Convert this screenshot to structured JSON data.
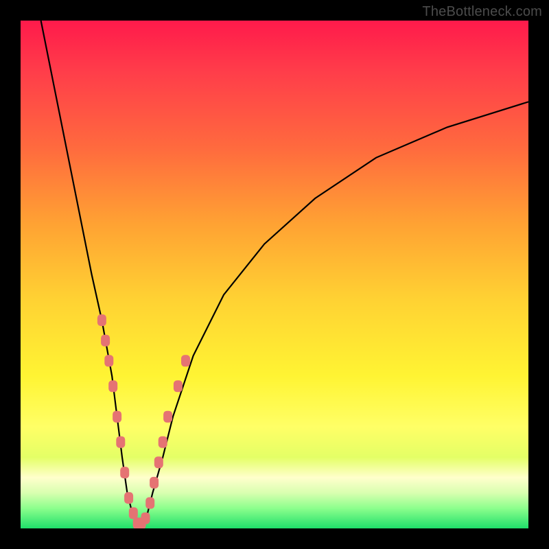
{
  "watermark": "TheBottleneck.com",
  "chart_data": {
    "type": "line",
    "title": "",
    "xlabel": "",
    "ylabel": "",
    "xlim": [
      0,
      100
    ],
    "ylim": [
      0,
      100
    ],
    "background_gradient": {
      "direction": "vertical",
      "stops": [
        {
          "pos": 0,
          "color": "#ff1a4b"
        },
        {
          "pos": 25,
          "color": "#ff6a3e"
        },
        {
          "pos": 55,
          "color": "#ffd233"
        },
        {
          "pos": 80,
          "color": "#ffff66"
        },
        {
          "pos": 100,
          "color": "#1fdf6a"
        }
      ]
    },
    "series": [
      {
        "name": "bottleneck-curve",
        "color": "#000000",
        "x": [
          4,
          6,
          8,
          10,
          12,
          14,
          16,
          18,
          19,
          20,
          21,
          22,
          23,
          24,
          25,
          26,
          28,
          30,
          34,
          40,
          48,
          58,
          70,
          84,
          100
        ],
        "y": [
          100,
          90,
          80,
          70,
          60,
          50,
          41,
          30,
          22,
          14,
          7,
          3,
          1,
          1,
          3,
          7,
          14,
          22,
          34,
          46,
          56,
          65,
          73,
          79,
          84
        ]
      }
    ],
    "markers": {
      "name": "highlight-points",
      "color": "#e57373",
      "shape": "rounded-rect",
      "points_xy": [
        [
          16,
          41
        ],
        [
          16.7,
          37
        ],
        [
          17.4,
          33
        ],
        [
          18.2,
          28
        ],
        [
          19,
          22
        ],
        [
          19.7,
          17
        ],
        [
          20.5,
          11
        ],
        [
          21.3,
          6
        ],
        [
          22.2,
          3
        ],
        [
          23,
          1
        ],
        [
          23.8,
          1
        ],
        [
          24.6,
          2
        ],
        [
          25.5,
          5
        ],
        [
          26.3,
          9
        ],
        [
          27.2,
          13
        ],
        [
          28,
          17
        ],
        [
          29,
          22
        ],
        [
          31,
          28
        ],
        [
          32.5,
          33
        ]
      ]
    },
    "vertex_x": 23.5
  }
}
